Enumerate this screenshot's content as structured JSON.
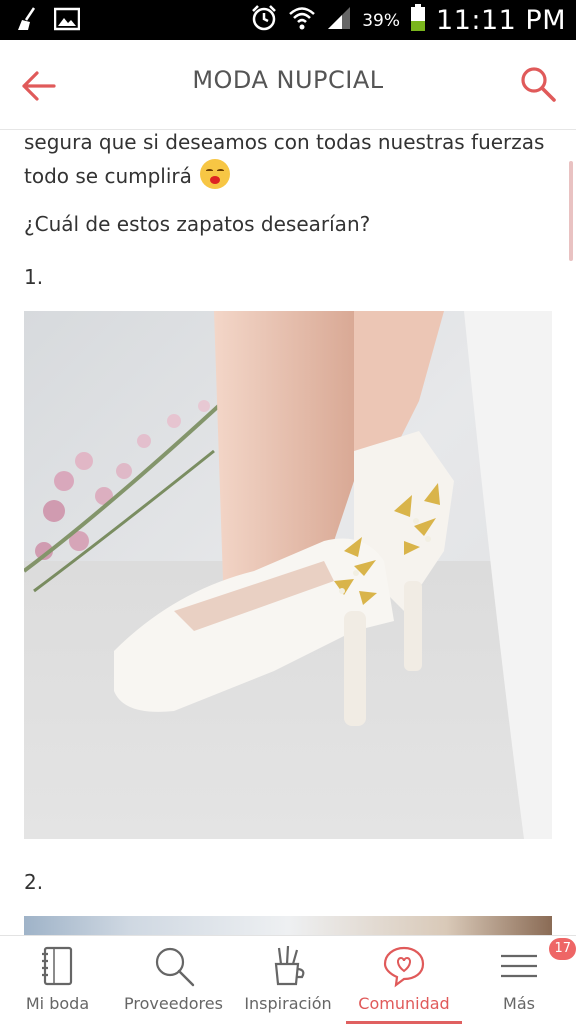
{
  "status_bar": {
    "battery_percent": "39%",
    "time": "11:11 PM",
    "left_icons": [
      "broom-icon",
      "image-icon"
    ],
    "right_icons": [
      "alarm-icon",
      "wifi-icon",
      "signal-icon",
      "battery-icon"
    ]
  },
  "header": {
    "title": "MODA NUPCIAL",
    "accent_color": "#e05a5a"
  },
  "post": {
    "paragraph_1": "segura que si deseamos con todas nuestras fuerzas todo se cumplirá",
    "paragraph_2": "¿Cuál de estos zapatos desearían?",
    "item_1_label": "1.",
    "item_2_label": "2."
  },
  "bottom_nav": {
    "items": [
      {
        "label": "Mi boda",
        "icon": "notebook-icon"
      },
      {
        "label": "Proveedores",
        "icon": "search-icon"
      },
      {
        "label": "Inspiración",
        "icon": "pencil-cup-icon"
      },
      {
        "label": "Comunidad",
        "icon": "chat-heart-icon",
        "active": true
      },
      {
        "label": "Más",
        "icon": "menu-icon",
        "badge": "17"
      }
    ]
  }
}
